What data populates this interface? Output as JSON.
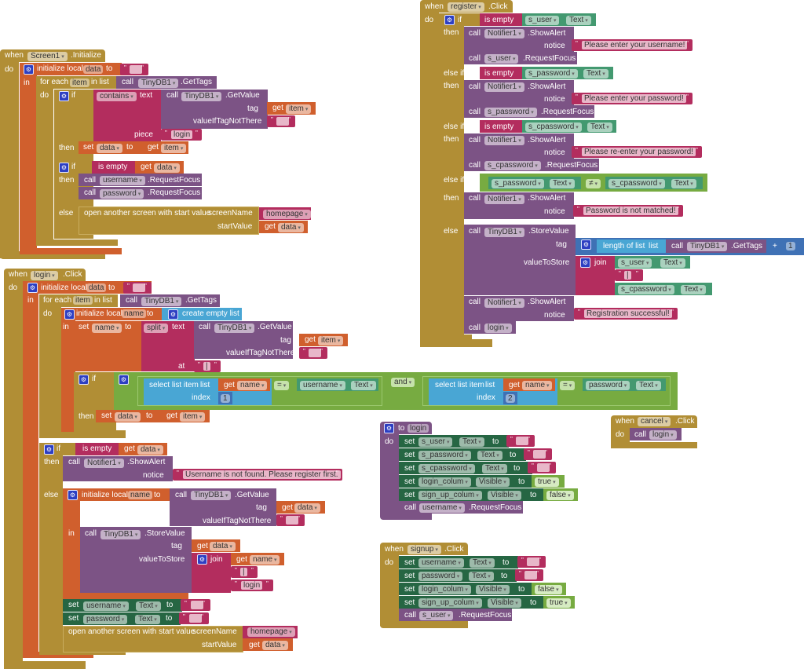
{
  "screen1_init": {
    "when": "when",
    "component": "Screen1",
    "event": ".Initialize",
    "do": "do",
    "init_local": "initialize local",
    "var_data": "data",
    "to": "to",
    "in": "in",
    "for_each": "for each",
    "item": "item",
    "in_list": "in list",
    "call": "call",
    "tinydb": "TinyDB1",
    "get_tags": ".GetTags",
    "if": "if",
    "contains": "contains",
    "text": "text",
    "get_value": ".GetValue",
    "tag": "tag",
    "get": "get",
    "value_if_not": "valueIfTagNotThere",
    "piece": "piece",
    "login_str": "login",
    "then": "then",
    "set": "set",
    "is_empty": "is empty",
    "username": "username",
    "password": "password",
    "request_focus": ".RequestFocus",
    "else": "else",
    "open_screen": "open another screen with start value",
    "screen_name": "screenName",
    "homepage": "homepage",
    "start_value": "startValue"
  },
  "login_click": {
    "when": "when",
    "component": "login",
    "event": ".Click",
    "do": "do",
    "init_local": "initialize local",
    "var_data": "data",
    "to": "to",
    "in": "in",
    "for_each": "for each",
    "item": "item",
    "in_list": "in list",
    "call": "call",
    "tinydb": "TinyDB1",
    "get_tags": ".GetTags",
    "var_name": "name",
    "create_empty_list": "create empty list",
    "set": "set",
    "split": "split",
    "text": "text",
    "get_value": ".GetValue",
    "tag": "tag",
    "get": "get",
    "value_if_not": "valueIfTagNotThere",
    "at": "at",
    "separator": "|",
    "if": "if",
    "select_list_item": "select list item",
    "list": "list",
    "index": "index",
    "eq": "=",
    "and": "and",
    "username": "username",
    "password": "password",
    "prop_text": "Text",
    "index1": "1",
    "index2": "2",
    "then": "then",
    "is_empty": "is empty",
    "notifier": "Notifier1",
    "show_alert": ".ShowAlert",
    "notice": "notice",
    "not_found_msg": "Username is not found. Please register first.",
    "else": "else",
    "store_value": ".StoreValue",
    "value_to_store": "valueToStore",
    "join": "join",
    "login_str": "login",
    "open_screen": "open another screen with start value",
    "screen_name": "screenName",
    "homepage": "homepage",
    "start_value": "startValue"
  },
  "register_click": {
    "when": "when",
    "component": "register",
    "event": ".Click",
    "do": "do",
    "if": "if",
    "else_if": "else if",
    "then": "then",
    "else": "else",
    "is_empty": "is empty",
    "s_user": "s_user",
    "s_password": "s_password",
    "s_cpassword": "s_cpassword",
    "prop_text": "Text",
    "call": "call",
    "notifier": "Notifier1",
    "show_alert": ".ShowAlert",
    "notice": "notice",
    "msg_username": "Please enter your username!",
    "msg_password": "Please enter your password!",
    "msg_repassword": "Please re-enter your password!",
    "msg_not_matched": "Password is not matched!",
    "msg_success": "Registration successful!",
    "request_focus": ".RequestFocus",
    "neq": "≠",
    "tinydb": "TinyDB1",
    "store_value": ".StoreValue",
    "tag": "tag",
    "length_of_list": "length of list",
    "list": "list",
    "get_tags": ".GetTags",
    "plus": "+",
    "one": "1",
    "value_to_store": "valueToStore",
    "join": "join",
    "separator": "|",
    "login_proc": "login"
  },
  "to_login_proc": {
    "to": "to",
    "name": "login",
    "do": "do",
    "set": "set",
    "to_kw": "to",
    "s_user": "s_user",
    "s_password": "s_password",
    "s_cpassword": "s_cpassword",
    "prop_text": "Text",
    "login_colum": "login_colum",
    "sign_up_colum": "sign_up_colum",
    "prop_visible": "Visible",
    "true": "true",
    "false": "false",
    "call": "call",
    "username": "username",
    "request_focus": ".RequestFocus"
  },
  "cancel_click": {
    "when": "when",
    "component": "cancel",
    "event": ".Click",
    "do": "do",
    "call": "call",
    "login_proc": "login"
  },
  "signup_click": {
    "when": "when",
    "component": "signup",
    "event": ".Click",
    "do": "do",
    "set": "set",
    "to": "to",
    "username": "username",
    "password": "password",
    "prop_text": "Text",
    "login_colum": "login_colum",
    "sign_up_colum": "sign_up_colum",
    "prop_visible": "Visible",
    "false": "false",
    "true": "true",
    "call": "call",
    "s_user": "s_user",
    "request_focus": ".RequestFocus"
  }
}
